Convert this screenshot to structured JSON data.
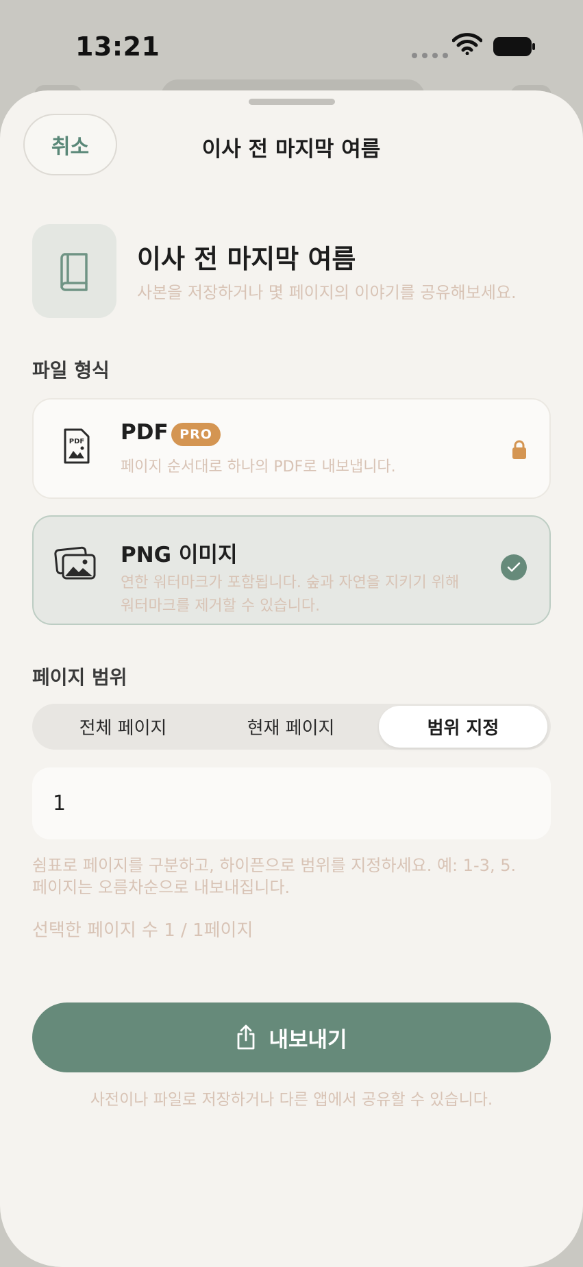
{
  "status": {
    "time": "13:21"
  },
  "nav": {
    "cancel_label": "취소",
    "title": "이사 전 마지막 여름"
  },
  "doc": {
    "title": "이사 전 마지막 여름",
    "subtitle": "사본을 저장하거나 몇 페이지의 이야기를 공유해보세요."
  },
  "format": {
    "section_label": "파일 형식",
    "options": [
      {
        "icon": "pdf-file-icon",
        "title": "PDF",
        "badge": "PRO",
        "desc_lines": [
          "페이지 순서대로 하나의 PDF로 내보냅니다."
        ],
        "locked": true,
        "selected": false
      },
      {
        "icon": "images-icon",
        "title": "PNG 이미지",
        "desc_lines": [
          "연한 워터마크가 포함됩니다. 숲과 자연을 지키기 위해",
          "워터마크를 제거할 수 있습니다."
        ],
        "locked": false,
        "selected": true
      }
    ]
  },
  "range": {
    "section_label": "페이지 범위",
    "segments": [
      "전체 페이지",
      "현재 페이지",
      "범위 지정"
    ],
    "selected_segment": "범위 지정",
    "input_value": "1",
    "help_lines": [
      "쉼표로 페이지를 구분하고, 하이픈으로 범위를 지정하세요. 예: 1-3, 5.",
      "페이지는 오름차순으로 내보내집니다."
    ],
    "count_text": "선택한 페이지 수 1 / 1페이지"
  },
  "export": {
    "button_label": "내보내기",
    "note": "사전이나 파일로 저장하거나 다른 앱에서 공유할 수 있습니다."
  },
  "colors": {
    "accent": "#668a7a",
    "pro_badge": "#d49552",
    "muted_text": "#d8c3b5",
    "sheet_bg": "#f5f3ef"
  }
}
